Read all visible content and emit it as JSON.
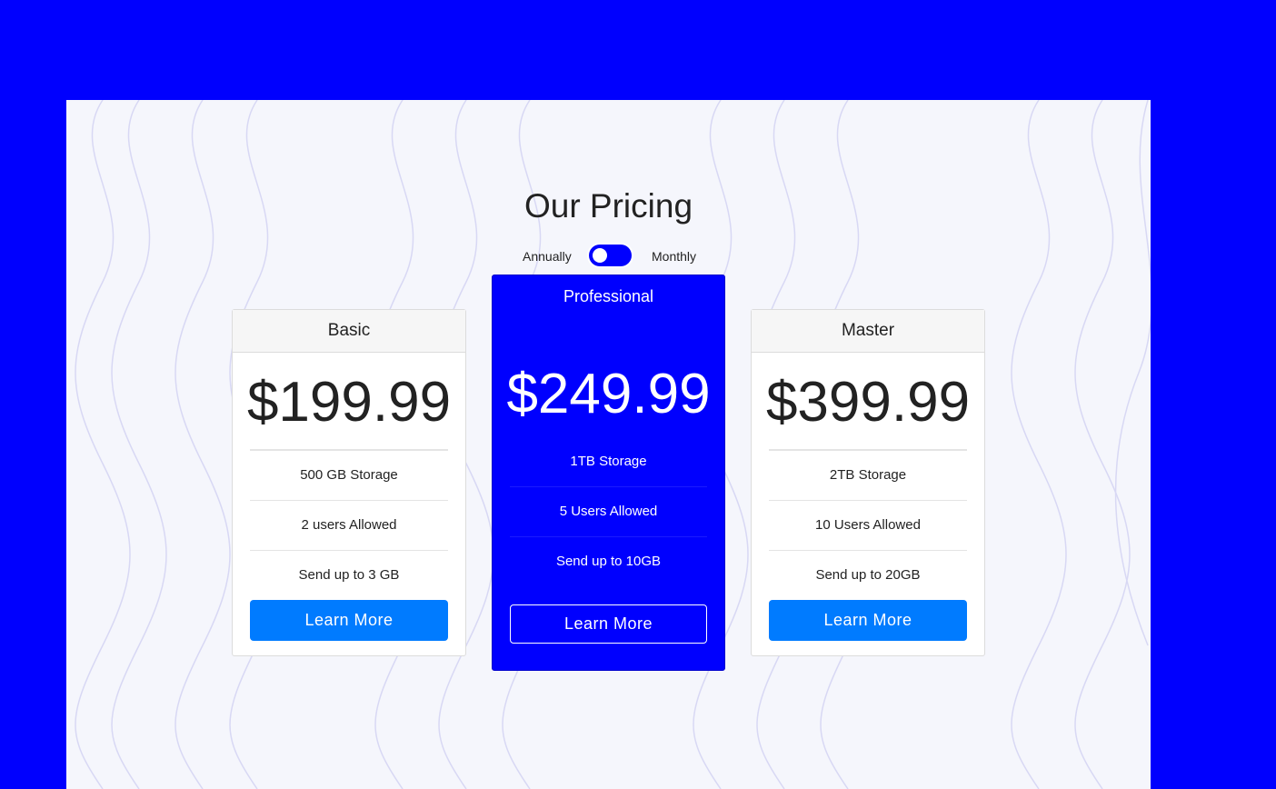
{
  "page": {
    "title": "Our Pricing",
    "toggle": {
      "left_label": "Annually",
      "right_label": "Monthly",
      "state": "monthly"
    }
  },
  "colors": {
    "brand_blue": "#0000fe",
    "button_blue": "#007bff",
    "panel_bg": "#f5f6fc"
  },
  "plans": [
    {
      "name": "Basic",
      "price": "$199.99",
      "features": [
        "500 GB Storage",
        "2 users Allowed",
        "Send up to 3 GB"
      ],
      "button": "Learn More"
    },
    {
      "name": "Professional",
      "price": "$249.99",
      "features": [
        "1TB Storage",
        "5 Users Allowed",
        "Send up to 10GB"
      ],
      "button": "Learn More"
    },
    {
      "name": "Master",
      "price": "$399.99",
      "features": [
        "2TB Storage",
        "10 Users Allowed",
        "Send up to 20GB"
      ],
      "button": "Learn More"
    }
  ]
}
